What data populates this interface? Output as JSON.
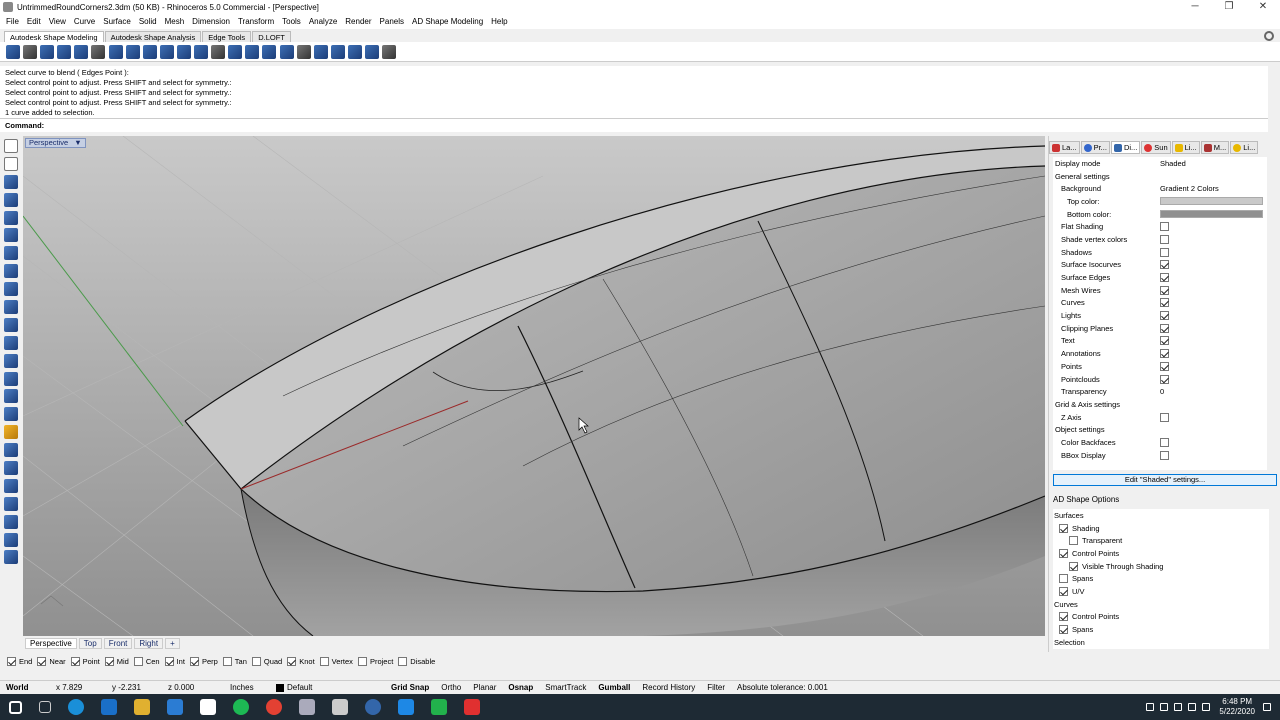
{
  "window": {
    "title": "UntrimmedRoundCorners2.3dm (50 KB) - Rhinoceros 5.0 Commercial - [Perspective]",
    "controls": [
      "─",
      "❐",
      "✕"
    ]
  },
  "menu": [
    "File",
    "Edit",
    "View",
    "Curve",
    "Surface",
    "Solid",
    "Mesh",
    "Dimension",
    "Transform",
    "Tools",
    "Analyze",
    "Render",
    "Panels",
    "AD Shape Modeling",
    "Help"
  ],
  "toolbar_tabs": [
    "Autodesk Shape Modeling",
    "Autodesk Shape Analysis",
    "Edge Tools",
    "D.LOFT"
  ],
  "command_history": [
    "Select curve to blend ( Edges  Point ):",
    "Select control point to adjust. Press SHIFT and select for symmetry.:",
    "Select control point to adjust. Press SHIFT and select for symmetry.:",
    "Select control point to adjust. Press SHIFT and select for symmetry.:",
    "1 curve added to selection."
  ],
  "command_prompt": "Command:",
  "viewport": {
    "label": "Perspective",
    "dropdown": "▼"
  },
  "viewport_tabs": [
    "Perspective",
    "Top",
    "Front",
    "Right",
    "+"
  ],
  "osnap": [
    {
      "label": "End",
      "checked": true
    },
    {
      "label": "Near",
      "checked": true
    },
    {
      "label": "Point",
      "checked": true
    },
    {
      "label": "Mid",
      "checked": true
    },
    {
      "label": "Cen",
      "checked": false
    },
    {
      "label": "Int",
      "checked": true
    },
    {
      "label": "Perp",
      "checked": true
    },
    {
      "label": "Tan",
      "checked": false
    },
    {
      "label": "Quad",
      "checked": false
    },
    {
      "label": "Knot",
      "checked": true
    },
    {
      "label": "Vertex",
      "checked": false
    },
    {
      "label": "Project",
      "checked": false
    },
    {
      "label": "Disable",
      "checked": false
    }
  ],
  "status": {
    "cplane": "World",
    "x": "x 7.829",
    "y": "y -2.231",
    "z": "z 0.000",
    "units": "Inches",
    "layer": "Default",
    "grid_snap": "Grid Snap",
    "ortho": "Ortho",
    "planar": "Planar",
    "osnap": "Osnap",
    "smarttrack": "SmartTrack",
    "gumball": "Gumball",
    "record": "Record History",
    "filter": "Filter",
    "tolerance": "Absolute tolerance: 0.001"
  },
  "panel_tabs": [
    "La...",
    "Pr...",
    "Di...",
    "Sun",
    "Li...",
    "M...",
    "Li..."
  ],
  "display_props": {
    "display_mode_label": "Display mode",
    "display_mode_value": "Shaded",
    "general": "General settings",
    "background_label": "Background",
    "background_value": "Gradient 2 Colors",
    "top_color": "Top color:",
    "bottom_color": "Bottom color:",
    "flags": [
      {
        "label": "Flat Shading",
        "checked": false
      },
      {
        "label": "Shade vertex colors",
        "checked": false
      },
      {
        "label": "Shadows",
        "checked": false
      },
      {
        "label": "Surface Isocurves",
        "checked": true
      },
      {
        "label": "Surface Edges",
        "checked": true
      },
      {
        "label": "Mesh Wires",
        "checked": true
      },
      {
        "label": "Curves",
        "checked": true
      },
      {
        "label": "Lights",
        "checked": true
      },
      {
        "label": "Clipping Planes",
        "checked": true
      },
      {
        "label": "Text",
        "checked": true
      },
      {
        "label": "Annotations",
        "checked": true
      },
      {
        "label": "Points",
        "checked": true
      },
      {
        "label": "Pointclouds",
        "checked": true
      }
    ],
    "transparency_label": "Transparency",
    "transparency_value": "0",
    "grid_axis": "Grid & Axis settings",
    "zaxis_label": "Z Axis",
    "object_settings": "Object settings",
    "color_backfaces": "Color Backfaces",
    "bbox_display": "BBox Display",
    "edit_button": "Edit \"Shaded\" settings..."
  },
  "ad_shape": {
    "header": "AD Shape Options",
    "items": [
      {
        "label": "Surfaces",
        "level": 0,
        "checkbox": false
      },
      {
        "label": "Shading",
        "level": 1,
        "checkbox": true,
        "checked": true
      },
      {
        "label": "Transparent",
        "level": 2,
        "checkbox": true,
        "checked": false
      },
      {
        "label": "Control Points",
        "level": 1,
        "checkbox": true,
        "checked": true
      },
      {
        "label": "Visible Through Shading",
        "level": 2,
        "checkbox": true,
        "checked": true
      },
      {
        "label": "Spans",
        "level": 1,
        "checkbox": true,
        "checked": false
      },
      {
        "label": "U/V",
        "level": 1,
        "checkbox": true,
        "checked": true
      },
      {
        "label": "Curves",
        "level": 0,
        "checkbox": false
      },
      {
        "label": "Control Points",
        "level": 1,
        "checkbox": true,
        "checked": true
      },
      {
        "label": "Spans",
        "level": 1,
        "checkbox": true,
        "checked": true
      },
      {
        "label": "Selection",
        "level": 0,
        "checkbox": false
      }
    ]
  },
  "taskbar": {
    "time": "6:48 PM",
    "date": "5/22/2020"
  },
  "colors": {
    "viewport_top": "#c9c9c9",
    "viewport_bottom": "#909090",
    "accent": "#0078d7",
    "taskbar": "#1e2a34"
  }
}
